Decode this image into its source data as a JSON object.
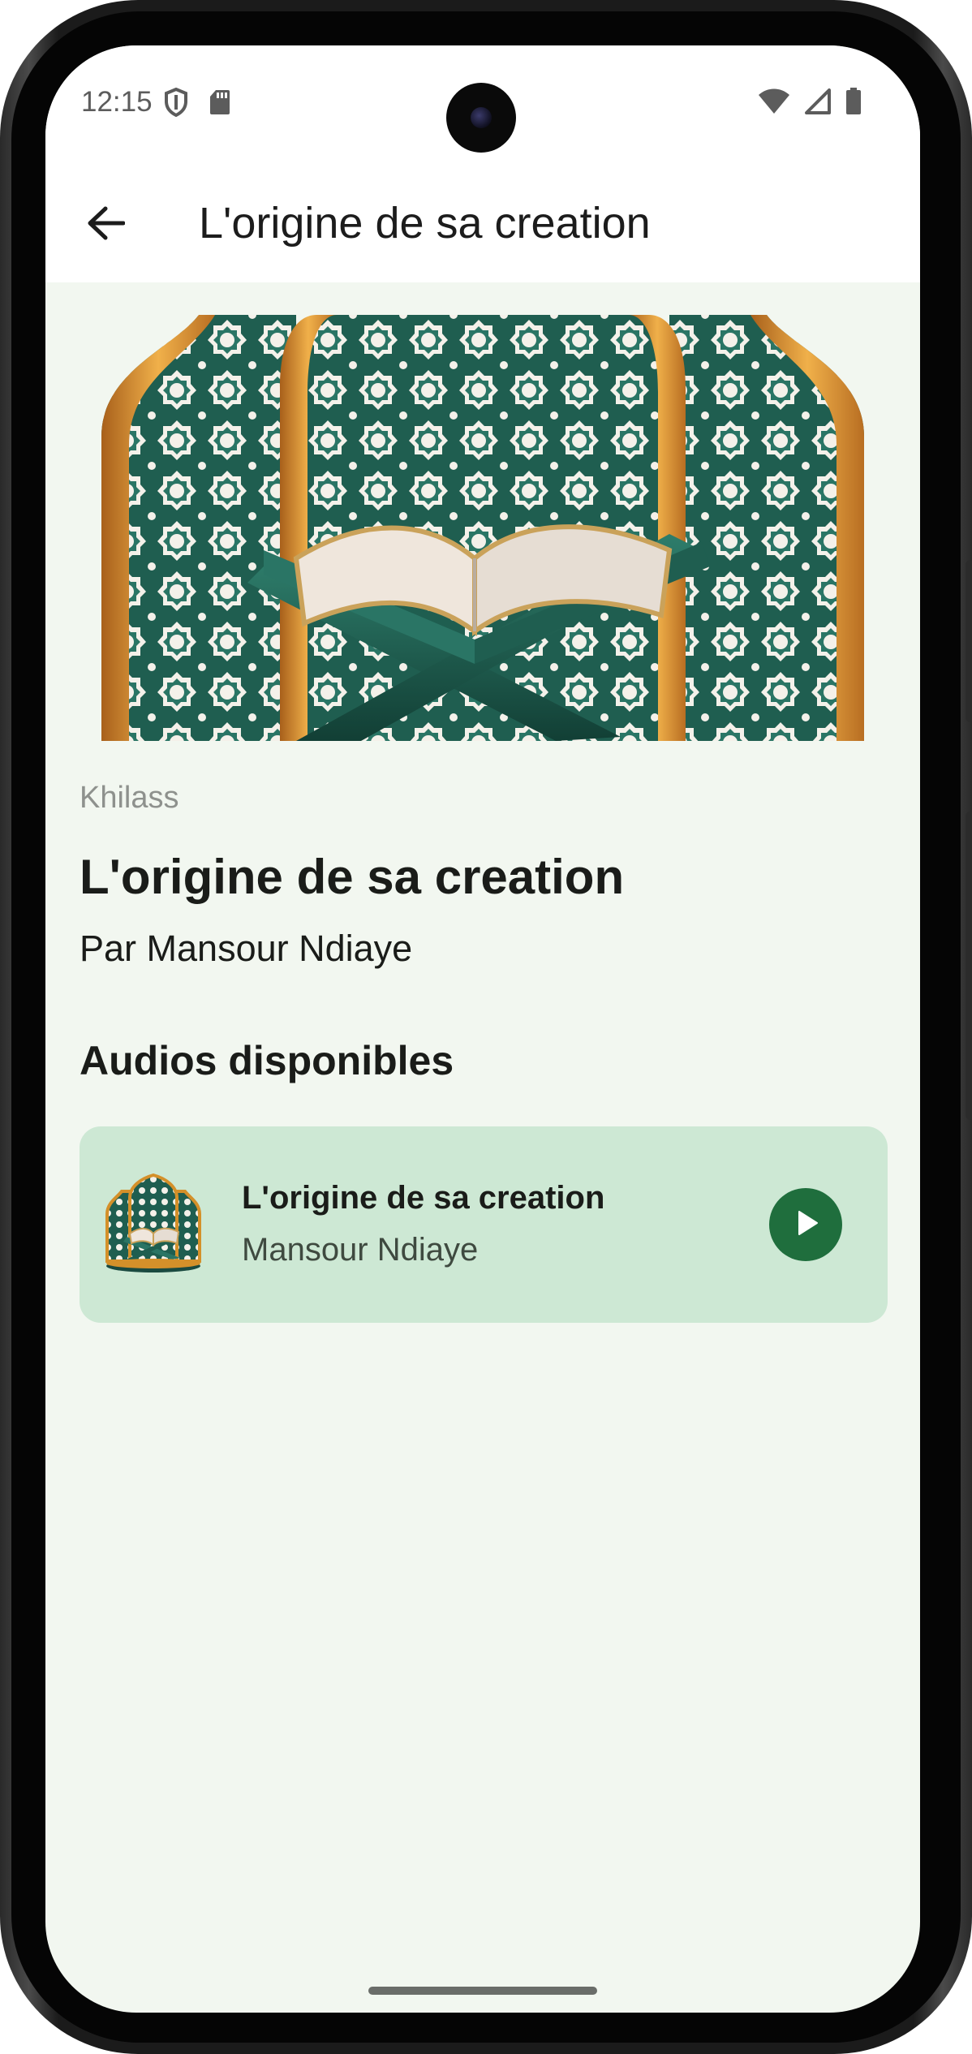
{
  "status_bar": {
    "time": "12:15",
    "left_icons": [
      "shield-icon",
      "sd-card-icon"
    ],
    "right_icons": [
      "wifi-icon",
      "cell-signal-icon",
      "battery-icon"
    ]
  },
  "app_bar": {
    "back_icon": "arrow-back-icon",
    "title": "L'origine de sa creation"
  },
  "hero": {
    "image": "quran-on-stand-with-islamic-arches-illustration"
  },
  "details": {
    "category": "Khilass",
    "title": "L'origine de sa creation",
    "author": "Par Mansour Ndiaye"
  },
  "audios_section": {
    "heading": "Audios disponibles",
    "items": [
      {
        "title": "L'origine de sa creation",
        "artist": "Mansour Ndiaye",
        "action_icon": "play-icon"
      }
    ]
  },
  "colors": {
    "background": "#f2f7f0",
    "card": "#cde8d4",
    "accent": "#1f6e3d",
    "ornament_teal": "#1f5e50",
    "ornament_gold": "#d4902a"
  }
}
